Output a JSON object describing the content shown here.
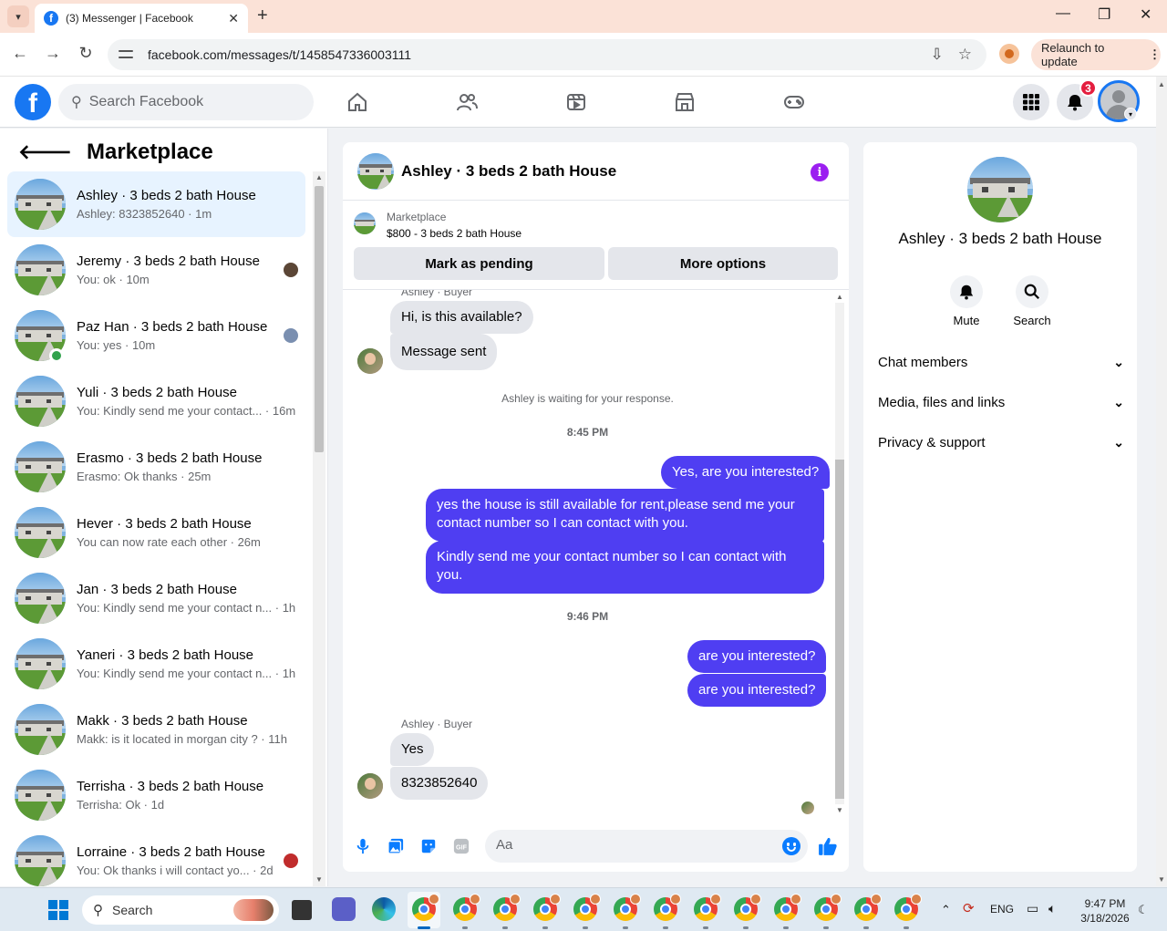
{
  "browser": {
    "tab_title": "(3) Messenger | Facebook",
    "url": "facebook.com/messages/t/1458547336003111",
    "relaunch_label": "Relaunch to update"
  },
  "fb": {
    "search_placeholder": "Search Facebook",
    "notification_count": "3"
  },
  "left": {
    "title": "Marketplace",
    "conversations": [
      {
        "name": "Ashley · 3 beds 2 bath House",
        "snippet": "Ashley: 8323852640 · 1m",
        "active": true
      },
      {
        "name": "Jeremy · 3 beds 2 bath House",
        "snippet": "You: ok · 10m"
      },
      {
        "name": "Paz Han · 3 beds 2 bath House",
        "snippet": "You: yes · 10m"
      },
      {
        "name": "Yuli · 3 beds 2 bath House",
        "snippet": "You: Kindly send me your contact... · 16m"
      },
      {
        "name": "Erasmo · 3 beds 2 bath House",
        "snippet": "Erasmo: Ok thanks · 25m"
      },
      {
        "name": "Hever · 3 beds 2 bath House",
        "snippet": "You can now rate each other · 26m"
      },
      {
        "name": "Jan · 3 beds 2 bath House",
        "snippet": "You: Kindly send me your contact n... · 1h"
      },
      {
        "name": "Yaneri · 3 beds 2 bath House",
        "snippet": "You: Kindly send me your contact n... · 1h"
      },
      {
        "name": "Makk · 3 beds 2 bath House",
        "snippet": "Makk: is it located in morgan city ? · 11h"
      },
      {
        "name": "Terrisha · 3 beds 2 bath House",
        "snippet": "Terrisha: Ok · 1d"
      },
      {
        "name": "Lorraine · 3 beds 2 bath House",
        "snippet": "You: Ok thanks i will contact yo... · 2d"
      }
    ]
  },
  "chat": {
    "title": "Ashley · 3 beds 2 bath House",
    "marketplace_label": "Marketplace",
    "listing": "$800 - 3 beds 2 bath House",
    "mark_pending": "Mark as pending",
    "more_options": "More options",
    "sender_label": "Ashley · Buyer",
    "msg_in_1": "Hi, is this available?",
    "msg_in_2": "Message sent",
    "waiting_note": "Ashley is waiting for your response.",
    "time_1": "8:45 PM",
    "msg_out_1": "Yes, are you interested?",
    "msg_out_2": "yes the house is still available for rent,please send me your contact number so I can contact with you.",
    "msg_out_3": "Kindly send me your contact number so I can contact with you.",
    "time_2": "9:46 PM",
    "msg_out_4": "are you interested?",
    "msg_out_5": "are you interested?",
    "msg_in_3": "Yes",
    "msg_in_4": "8323852640",
    "composer_placeholder": "Aa"
  },
  "right": {
    "name": "Ashley · 3 beds 2 bath House",
    "mute_label": "Mute",
    "search_label": "Search",
    "sections": [
      "Chat members",
      "Media, files and links",
      "Privacy & support"
    ]
  },
  "taskbar": {
    "search_label": "Search",
    "lang": "ENG",
    "time": "9:47 PM",
    "date": "3/18/2026"
  },
  "colors": {
    "fb_blue": "#1877f2",
    "outgoing_bubble": "#4f3ef2",
    "incoming_bubble": "#e4e6eb",
    "active_row": "#e7f3ff",
    "badge_red": "#e41e3f"
  }
}
